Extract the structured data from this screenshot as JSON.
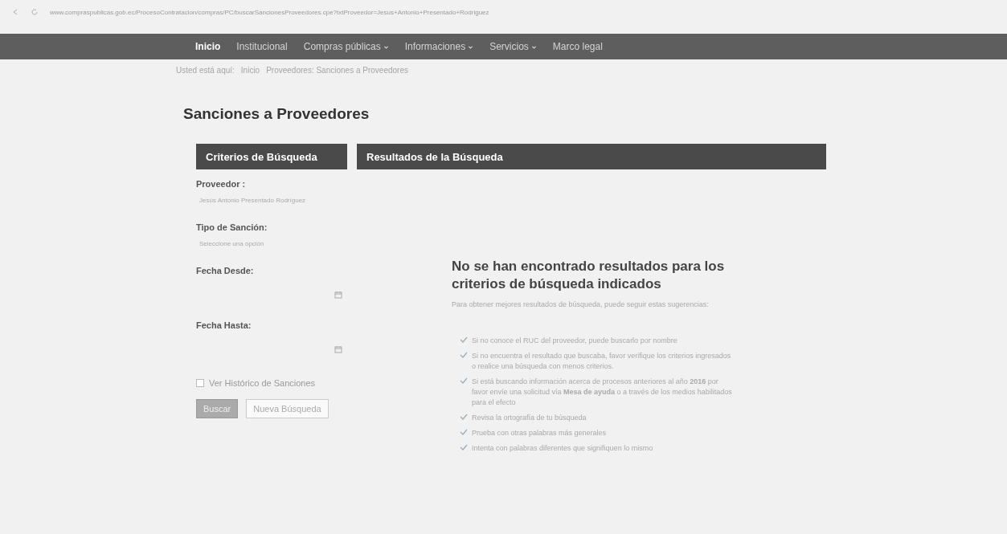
{
  "browser": {
    "url": "www.compraspublicas.gob.ec/ProcesoContratacion/compras/PC/buscarSancionesProveedores.cpe?txtProveedor=Jesus+Antonio+Presentado+Rodriguez"
  },
  "nav": [
    {
      "label": "Inicio",
      "selected": true,
      "dropdown": false
    },
    {
      "label": "Institucional",
      "selected": false,
      "dropdown": false
    },
    {
      "label": "Compras públicas",
      "selected": false,
      "dropdown": true
    },
    {
      "label": "Informaciones",
      "selected": false,
      "dropdown": true
    },
    {
      "label": "Servicios",
      "selected": false,
      "dropdown": true
    },
    {
      "label": "Marco legal",
      "selected": false,
      "dropdown": false
    }
  ],
  "breadcrumb": {
    "prefix": "Usted está aquí:",
    "items": [
      "Inicio",
      "Proveedores: Sanciones a Proveedores"
    ]
  },
  "title": "Sanciones a Proveedores",
  "panels": [
    "Criterios de Búsqueda",
    "Resultados de la Búsqueda"
  ],
  "form": {
    "fields": [
      {
        "kind": "text",
        "label": "Proveedor :",
        "value": "Jesús Antonio Presentado Rodríguez"
      },
      {
        "kind": "select",
        "label": "Tipo de Sanción:",
        "value": "Seleccione una opción"
      },
      {
        "kind": "date",
        "label": "Fecha Desde:"
      },
      {
        "kind": "date",
        "label": "Fecha Hasta:"
      }
    ],
    "history": {
      "label": "Ver Histórico de Sanciones",
      "checked": false
    },
    "buttons": [
      {
        "label": "Buscar",
        "kind": "primary"
      },
      {
        "label": "Nueva Búsqueda",
        "kind": "secondary"
      }
    ]
  },
  "results": {
    "heading": "No se han encontrado resultados para los criterios de búsqueda indicados",
    "intro": "Para obtener mejores resultados de búsqueda, puede seguir estas sugerencias:",
    "tips": [
      "Si no conoce el RUC del proveedor, puede buscarlo por nombre",
      "Si no encuentra el resultado que buscaba, favor verifique los criterios ingresados o realice una búsqueda con menos criterios.",
      "Si está buscando información acerca de procesos anteriores al año **2016** por favor envíe una solicitud vía **Mesa de ayuda** o a través de los medios habilitados para el efecto",
      "Revisa la ortografía de tu búsqueda",
      "Prueba con otras palabras más generales",
      "Intenta con palabras diferentes que signifiquen lo mismo"
    ]
  }
}
